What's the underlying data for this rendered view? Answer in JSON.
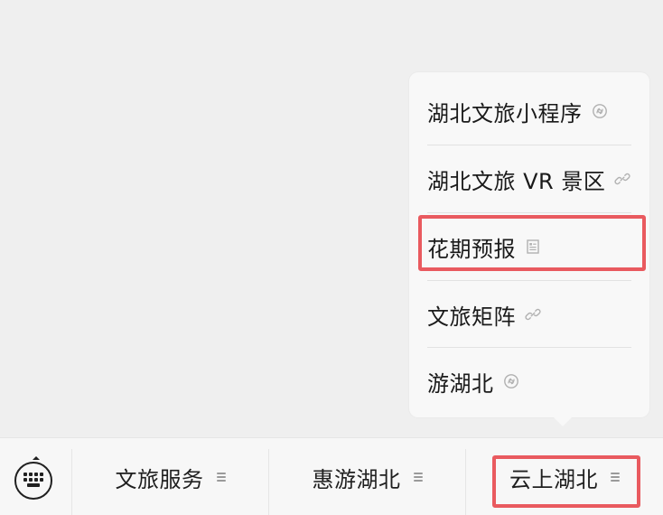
{
  "menu": {
    "items": [
      {
        "label": "湖北文旅小程序",
        "icon": "mini-program-icon"
      },
      {
        "label": "湖北文旅 VR 景区",
        "icon": "link-icon"
      },
      {
        "label": "花期预报",
        "icon": "article-icon"
      },
      {
        "label": "文旅矩阵",
        "icon": "link-icon"
      },
      {
        "label": "游湖北",
        "icon": "mini-program-icon"
      }
    ]
  },
  "bottom_bar": {
    "tabs": [
      {
        "label": "文旅服务",
        "icon": "menu-icon"
      },
      {
        "label": "惠游湖北",
        "icon": "menu-icon"
      },
      {
        "label": "云上湖北",
        "icon": "menu-icon"
      }
    ],
    "keyboard_icon": "keyboard-icon"
  },
  "colors": {
    "background": "#efefef",
    "popup": "#f8f8f8",
    "highlight": "#e95a5f",
    "text": "#1a1a1a",
    "icon_gray": "#9a9a9a"
  }
}
